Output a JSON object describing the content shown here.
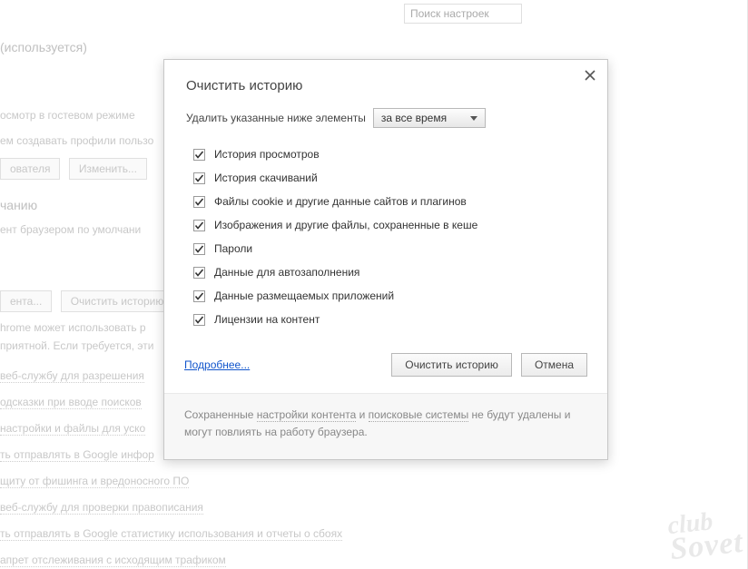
{
  "bg": {
    "search_placeholder": "Поиск настроек",
    "using_label": "(используется)",
    "line_guest": "осмотр в гостевом режиме",
    "line_profiles": "ем создавать профили пользо",
    "btn_user": "ователя",
    "btn_edit": "Изменить...",
    "section_default": "чанию",
    "line_default_browser": "ент браузером по умолчани",
    "btn_content": "ента...",
    "btn_clear": "Очистить историю",
    "priv1": "hrome может использовать р",
    "priv2": "приятной. Если требуется, эти",
    "links": [
      "веб-службу для разрешения",
      "одсказки при вводе поисков",
      "настройки и файлы для уско",
      "ть отправлять в Google инфор",
      "щиту от фишинга и вредоносного ПО",
      "веб-службу для проверки правописания",
      "ть отправлять в Google статистику использования и отчеты о сбоях",
      "апрет отслеживания с исходящим трафиком"
    ]
  },
  "dialog": {
    "title": "Очистить историю",
    "prompt": "Удалить указанные ниже элементы",
    "range_selected": "за все время",
    "checks": [
      {
        "checked": true,
        "label": "История просмотров"
      },
      {
        "checked": true,
        "label": "История скачиваний"
      },
      {
        "checked": true,
        "label": "Файлы cookie и другие данные сайтов и плагинов"
      },
      {
        "checked": true,
        "label": "Изображения и другие файлы, сохраненные в кеше"
      },
      {
        "checked": true,
        "label": "Пароли"
      },
      {
        "checked": true,
        "label": "Данные для автозаполнения"
      },
      {
        "checked": true,
        "label": "Данные размещаемых приложений"
      },
      {
        "checked": true,
        "label": "Лицензии на контент"
      }
    ],
    "learn_more": "Подробнее...",
    "confirm": "Очистить историю",
    "cancel": "Отмена",
    "footer_pre": "Сохраненные ",
    "footer_link1": "настройки контента",
    "footer_mid": " и ",
    "footer_link2": "поисковые системы",
    "footer_post": " не будут удалены и могут повлиять на работу браузера."
  },
  "watermark": {
    "l1": "club",
    "l2": "Sovet"
  }
}
